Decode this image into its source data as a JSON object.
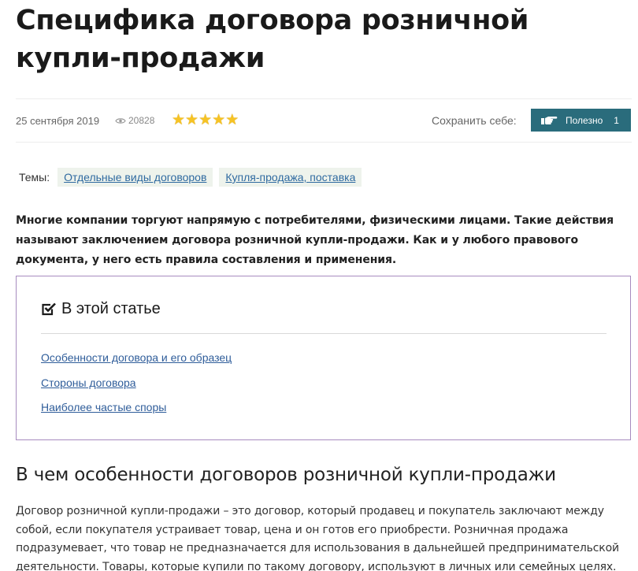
{
  "article": {
    "title": "Специфика договора розничной купли-продажи",
    "date": "25 сентября 2019",
    "views": "20828",
    "rating_stars": 5,
    "save_label": "Сохранить себе:",
    "useful_label": "Полезно",
    "useful_count": "1",
    "topics_label": "Темы:",
    "topics": [
      "Отдельные виды договоров",
      "Купля-продажа, поставка"
    ],
    "lead": "Многие компании торгуют напрямую с потребителями, физическими лицами. Такие действия называют заключением договора розничной купли-продажи. Как и у любого правового документа, у него есть правила составления и применения."
  },
  "toc": {
    "heading": "В этой статье",
    "links": [
      "Особенности договора и его образец",
      "Стороны договора",
      "Наиболее частые споры"
    ]
  },
  "section": {
    "heading": "В чем особенности договоров розничной купли-продажи",
    "paragraph": "Договор розничной купли-продажи – это договор, который продавец и покупатель заключают между собой, если покупателя устраивает товар, цена и он готов его приобрести. Розничная продажа подразумевает, что товар не предназначается для использования в дальнейшей предпринимательской деятельности. Товары, которые купили по такому договору, используют в личных или семейных целях."
  },
  "colors": {
    "accent_button": "#2a6c7c",
    "toc_border": "#a78bbf",
    "link": "#2f5d9a",
    "star": "#f6c324",
    "tag_bg": "#eef3ec"
  }
}
